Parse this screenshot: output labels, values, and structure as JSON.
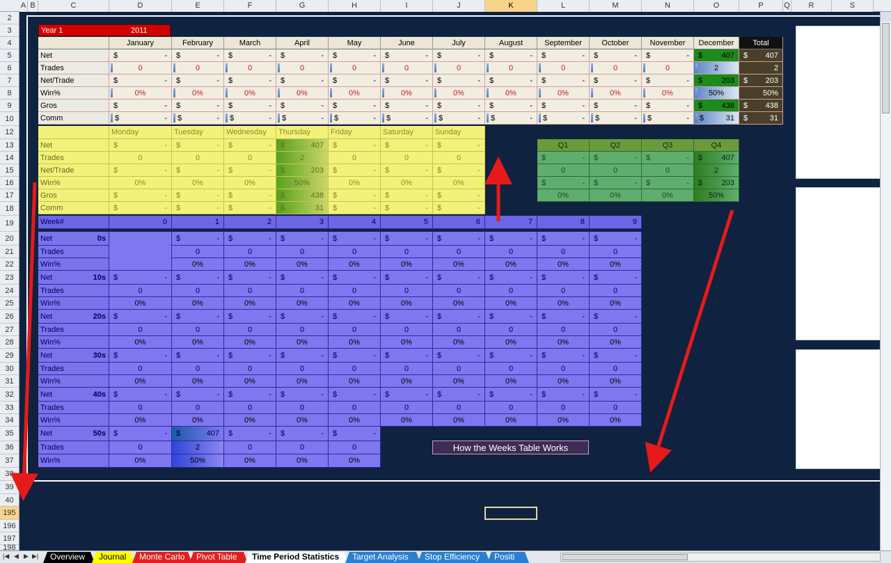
{
  "column_headers": [
    "A",
    "B",
    "C",
    "D",
    "E",
    "F",
    "G",
    "H",
    "I",
    "J",
    "K",
    "L",
    "M",
    "N",
    "O",
    "P",
    "Q",
    "R",
    "S"
  ],
  "selected_column": "K",
  "row_headers": [
    "2",
    "3",
    "4",
    "5",
    "6",
    "7",
    "8",
    "9",
    "10",
    "12",
    "13",
    "14",
    "15",
    "16",
    "17",
    "18",
    "19",
    "20",
    "21",
    "22",
    "23",
    "24",
    "25",
    "26",
    "27",
    "28",
    "29",
    "30",
    "31",
    "32",
    "33",
    "34",
    "35",
    "36",
    "37",
    "38",
    "39",
    "40",
    "195",
    "196",
    "197",
    "198"
  ],
  "selected_row": "195",
  "year": {
    "label": "Year 1",
    "value": "2011"
  },
  "monthly": {
    "months": [
      "January",
      "February",
      "March",
      "April",
      "May",
      "June",
      "July",
      "August",
      "September",
      "October",
      "November",
      "December"
    ],
    "total_label": "Total",
    "row_labels": [
      "Net",
      "Trades",
      "Net/Trade",
      "Win%",
      "Gros",
      "Comm"
    ],
    "dollar": "$",
    "dash": "-",
    "zero": "0",
    "zero_pct": "0%",
    "dec_net": "407",
    "dec_trades": "2",
    "dec_net_trade": "203",
    "dec_win": "50%",
    "dec_gros": "438",
    "dec_comm": "31",
    "tot_net": "407",
    "tot_trades": "2",
    "tot_net_trade": "203",
    "tot_win": "50%",
    "tot_gros": "438",
    "tot_comm": "31"
  },
  "daily": {
    "days": [
      "Monday",
      "Tuesday",
      "Wednesday",
      "Thursday",
      "Friday",
      "Saturday",
      "Sunday"
    ],
    "row_labels": [
      "Net",
      "Trades",
      "Net/Trade",
      "Win%",
      "Gros",
      "Comm"
    ],
    "thu_net": "407",
    "thu_trades": "2",
    "thu_net_trade": "203",
    "thu_win": "50%",
    "thu_gros": "438",
    "thu_comm": "31"
  },
  "quarters": {
    "labels": [
      "Q1",
      "Q2",
      "Q3",
      "Q4"
    ],
    "q4_net": "407",
    "q4_trades": "2",
    "q4_net_trade": "203",
    "q4_win": "50%"
  },
  "weeks": {
    "header_label": "Week#",
    "columns": [
      "0",
      "1",
      "2",
      "3",
      "4",
      "5",
      "6",
      "7",
      "8",
      "9"
    ],
    "groups": [
      "0s",
      "10s",
      "20s",
      "30s",
      "40s",
      "50s"
    ],
    "row_labels": [
      "Net",
      "Trades",
      "Win%"
    ],
    "w51_net": "407",
    "w51_trades": "2",
    "w51_win": "50%"
  },
  "button_label": "How the Weeks Table Works",
  "tabs": [
    {
      "label": "Overview",
      "color": "#000000",
      "text": "#ffffff"
    },
    {
      "label": "Journal",
      "color": "#ffff00",
      "text": "#000000"
    },
    {
      "label": "Monte Carlo",
      "color": "#e02020",
      "text": "#ffffff"
    },
    {
      "label": "Pivot Table",
      "color": "#e02020",
      "text": "#ffffff"
    },
    {
      "label": "Time Period Statistics",
      "color": "#ffffff",
      "text": "#000000"
    },
    {
      "label": "Target Analysis",
      "color": "#2a7fd0",
      "text": "#ffffff"
    },
    {
      "label": "Stop Efficiency",
      "color": "#2a7fd0",
      "text": "#ffffff"
    },
    {
      "label": "Positi",
      "color": "#2a7fd0",
      "text": "#ffffff"
    }
  ],
  "active_tab": "Time Period Statistics"
}
